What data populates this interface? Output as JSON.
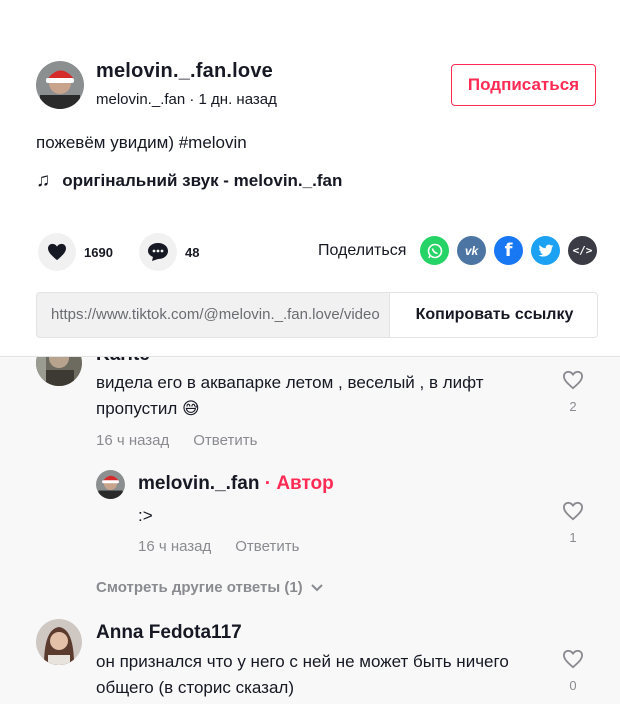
{
  "post": {
    "author_name": "melovin._.fan.love",
    "author_sub": "melovin._.fan · 1 дн. назад",
    "follow_label": "Подписаться",
    "description": "пожевём увидим) #melovin",
    "music": "оригінальний звук - melovin._.fan",
    "likes": "1690",
    "comments_count": "48",
    "share_label": "Поделиться",
    "link": "https://www.tiktok.com/@melovin._.fan.love/video",
    "copy_label": "Копировать ссылку",
    "share_icons": [
      "whatsapp-icon",
      "vk-icon",
      "facebook-icon",
      "twitter-icon",
      "embed-icon"
    ]
  },
  "comments": [
    {
      "name": "Karitе",
      "text": "видела его в аквапарке летом , веселый , в лифт пропустил 😅",
      "time": "16 ч назад",
      "reply_label": "Ответить",
      "likes": "2"
    },
    {
      "name": "melovin._.fan",
      "author_tag": "Автор",
      "text": ":>",
      "time": "16 ч назад",
      "reply_label": "Ответить",
      "likes": "1"
    },
    {
      "name": "Anna Fedota117",
      "text": "он признался что у него с ней не может быть ничего общего (в сторис сказал)",
      "likes": "0"
    }
  ],
  "more_replies": "Смотреть другие ответы (1)",
  "colors": {
    "accent": "#fe2c55",
    "text": "#161823",
    "muted": "#8a8b91"
  }
}
